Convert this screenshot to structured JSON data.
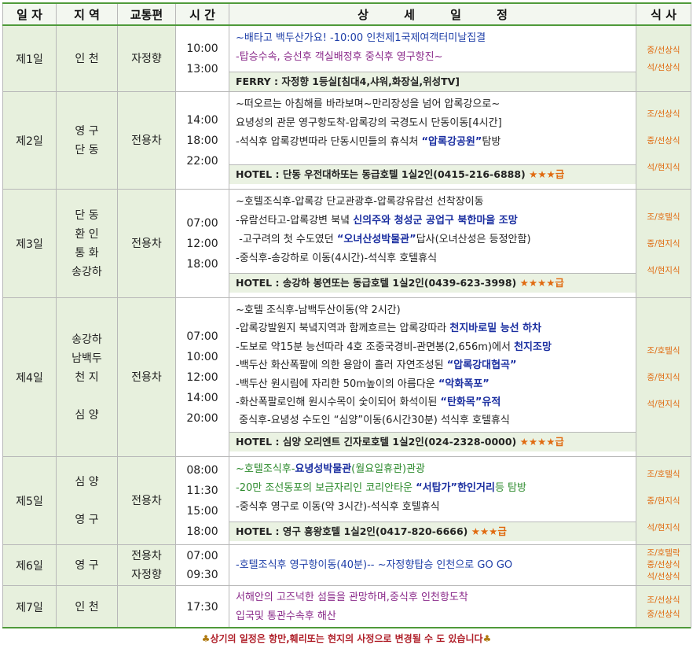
{
  "header": {
    "day": "일 자",
    "region": "지 역",
    "transport": "교통편",
    "time": "시 간",
    "detail": "상 세 일 정",
    "meal": "식 사"
  },
  "days": [
    {
      "day": "제1일",
      "region": [
        "인 천"
      ],
      "transport": [
        "자정향"
      ],
      "times": [
        "10:00",
        "13:00"
      ],
      "lines": [
        "~배타고 백두산가요! -10:00 인천제1국제여객터미날집결",
        "-탑승수속, 승선후 객실배정후 중식후 영구항진~"
      ],
      "hotel": "FERRY : 자정향 1등실[침대4,샤워,화장실,위성TV]",
      "hotel_stars": "",
      "meals": [
        "중/선상식",
        "석/선상식"
      ]
    },
    {
      "day": "제2일",
      "region": [
        "영 구",
        "단 동"
      ],
      "transport": [
        "전용차"
      ],
      "times": [
        "14:00",
        "18:00",
        "22:00"
      ],
      "lines": [
        "~떠오르는 아침해를 바라보며~만리장성을 넘어 압록강으로~",
        "요녕성의 관문 영구항도착-압록강의 국경도시 단동이동[4시간]",
        "-석식후 압록강변따라 단동시민들의 휴식처 ",
        "“압록강공원”",
        "탐방"
      ],
      "hotel": "HOTEL : 단동 우전대하또는 동급호텔 1실2인(0415-216-6888)",
      "hotel_stars": "★★★급",
      "meals": [
        "조/선상식",
        "중/선상식",
        "석/현지식"
      ]
    },
    {
      "day": "제3일",
      "region": [
        "단 동",
        "환 인",
        "통 화",
        "송강하"
      ],
      "transport": [
        "전용차"
      ],
      "times": [
        "07:00",
        "12:00",
        "18:00"
      ],
      "lines": [
        "~호텔조식후-압록강 단교관광후-압록강유람선 선착장이동",
        "-유람선타고-압록강변 북녘 ",
        "신의주와 청성군 공업구 북한마을 조망",
        " -고구려의 첫 수도였던 ",
        "“오녀산성박물관”",
        "답사(오녀산성은 등정안함)",
        "-중식후-송강하로 이동(4시간)-석식후 호텔휴식"
      ],
      "hotel": "HOTEL : 송강하 봉연또는 동급호텔 1실2인(0439-623-3998)",
      "hotel_stars": "★★★★급",
      "meals": [
        "조/호텔식",
        "중/현지식",
        "석/현지식"
      ]
    },
    {
      "day": "제4일",
      "region": [
        "송강하",
        "남백두",
        "천 지",
        "",
        "심 양"
      ],
      "transport": [
        "전용차"
      ],
      "times": [
        "07:00",
        "10:00",
        "12:00",
        "14:00",
        "20:00"
      ],
      "lines": [
        "~호텔 조식후-남백두산이동(약 2시간)",
        "-압록강발원지 북녘지역과 함께흐르는 압록강따라 ",
        "천지바로밑 능선 하차",
        "-도보로 약15분 능선따라 4호 조중국경비-관면봉(2,656m)에서 ",
        "천지조망",
        "-백두산 화산폭팔에 의한 용암이 흘러 자연조성된 ",
        "“압록강대협곡”",
        "-백두산 원시림에 자리한 50m높이의 아름다운 ",
        "“악화폭포”",
        "-화산폭팔로인해 원시수목이 숯이되어 화석이된 ",
        "“탄화목”유적",
        " 중식후-요녕성 수도인 “심양”이동(6시간30분) 석식후 호텔휴식"
      ],
      "hotel": "HOTEL : 심양 오리엔트 긴자로호텔 1실2인(024-2328-0000)",
      "hotel_stars": "★★★★급",
      "meals": [
        "조/호텔식",
        "중/현지식",
        "석/현지식"
      ]
    },
    {
      "day": "제5일",
      "region": [
        "심 양",
        "",
        "영 구"
      ],
      "transport": [
        "전용차"
      ],
      "times": [
        "08:00",
        "11:30",
        "15:00",
        "18:00"
      ],
      "lines": [
        "~호텔조식후-",
        "요녕성박물관",
        "(월요일휴관)관광",
        "-20만 조선동포의 보금자리인 코리안타운 ",
        "“서탑가”한인거리",
        "등 탐방",
        "-중식후 영구로 이동(약 3시간)-석식후 호텔휴식"
      ],
      "hotel": "HOTEL : 영구 흥왕호텔 1실2인(0417-820-6666)",
      "hotel_stars": "★★★급",
      "meals": [
        "조/호텔식",
        "중/현지식",
        "석/현지식"
      ]
    },
    {
      "day": "제6일",
      "region": [
        "영 구"
      ],
      "transport": [
        "전용차",
        "자정향"
      ],
      "times": [
        "07:00",
        "09:30"
      ],
      "lines": [
        "-호텔조식후 영구항이동(40분)-- ~자정향탑승 인천으로 GO GO"
      ],
      "hotel": "",
      "hotel_stars": "",
      "meals": [
        "조/호텔락",
        "중/선상식",
        "석/선상식"
      ]
    },
    {
      "day": "제7일",
      "region": [
        "인 천"
      ],
      "transport": [
        ""
      ],
      "times": [
        "17:30"
      ],
      "lines": [
        "서해안의 고즈넉한 섬들을 관망하며,중식후 인천항도착",
        "입국및 통관수속후 해산"
      ],
      "hotel": "",
      "hotel_stars": "",
      "meals": [
        "조/선상식",
        "중/선상식"
      ]
    }
  ],
  "footer": {
    "club_left": "♣",
    "text": "상기의 일정은 항만,훼리또는 현지의 사정으로 변경될 수 도 있습니다",
    "club_right": "♣"
  }
}
